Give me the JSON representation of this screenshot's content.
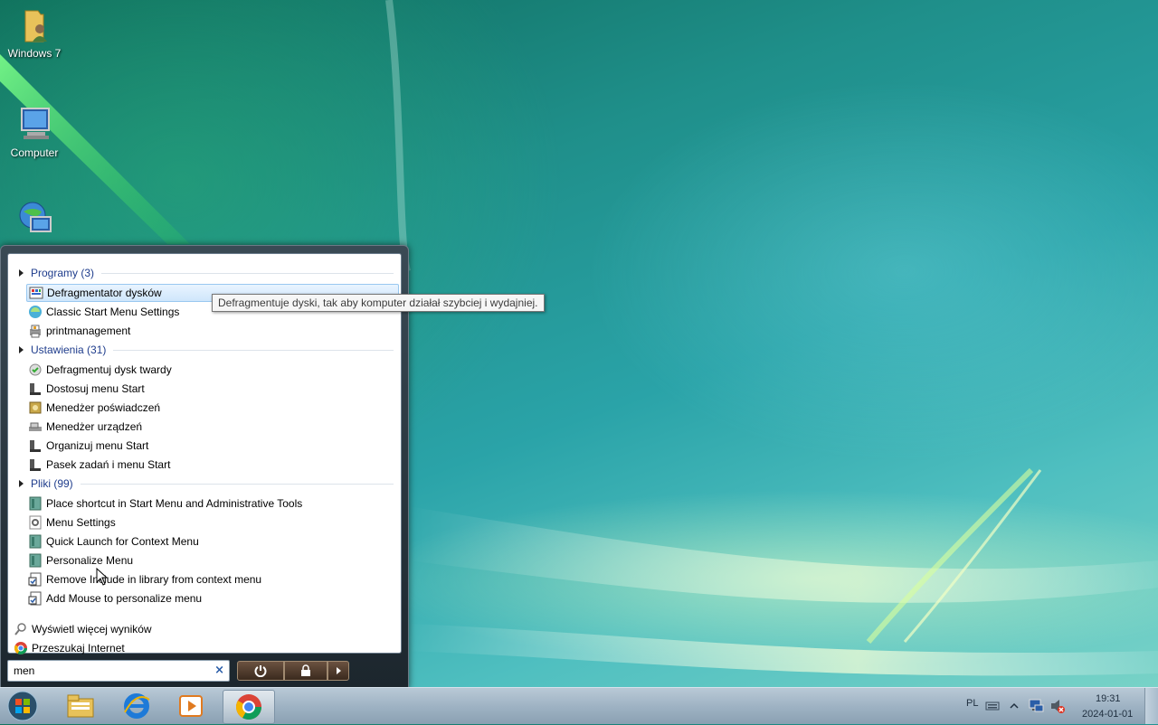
{
  "desktop": {
    "icons": [
      {
        "label": "Windows 7",
        "icon": "user-folder-icon"
      },
      {
        "label": "Computer",
        "icon": "computer-icon"
      },
      {
        "label": "",
        "icon": "network-globe-icon"
      }
    ]
  },
  "start_menu": {
    "groups": [
      {
        "header": "Programy (3)",
        "items": [
          {
            "label": "Defragmentator dysków",
            "icon": "defrag-icon",
            "selected": true
          },
          {
            "label": "Classic Start Menu Settings",
            "icon": "shell-orb-icon"
          },
          {
            "label": "printmanagement",
            "icon": "print-management-icon"
          }
        ]
      },
      {
        "header": "Ustawienia (31)",
        "items": [
          {
            "label": "Defragmentuj dysk twardy",
            "icon": "defrag-settings-icon"
          },
          {
            "label": "Dostosuj menu Start",
            "icon": "taskbar-settings-icon"
          },
          {
            "label": "Menedżer poświadczeń",
            "icon": "credential-manager-icon"
          },
          {
            "label": "Menedżer urządzeń",
            "icon": "device-manager-icon"
          },
          {
            "label": "Organizuj menu Start",
            "icon": "taskbar-settings-icon"
          },
          {
            "label": "Pasek zadań i menu Start",
            "icon": "taskbar-settings-icon"
          }
        ]
      },
      {
        "header": "Pliki (99)",
        "items": [
          {
            "label": "Place shortcut in Start Menu and Administrative Tools",
            "icon": "registry-file-icon"
          },
          {
            "label": "Menu Settings",
            "icon": "settings-file-icon"
          },
          {
            "label": "Quick Launch for Context Menu",
            "icon": "registry-file-icon"
          },
          {
            "label": "Personalize Menu",
            "icon": "registry-file-icon"
          },
          {
            "label": "Remove Include in library from context menu",
            "icon": "script-file-icon"
          },
          {
            "label": "Add Mouse to personalize menu",
            "icon": "script-file-icon"
          }
        ]
      }
    ],
    "see_more": "Wyświetl więcej wyników",
    "search_internet": "Przeszukaj Internet",
    "search": {
      "value": "men",
      "clear_icon": "×"
    },
    "power_buttons": [
      "power-icon",
      "lock-icon",
      "arrow-right-icon"
    ]
  },
  "tooltip": "Defragmentuje dyski, tak aby komputer działał szybciej i wydajniej.",
  "taskbar": {
    "pinned": [
      "explorer-icon",
      "internet-explorer-icon",
      "media-player-icon",
      "chrome-icon"
    ],
    "language": "PL",
    "time": "19:31",
    "date": "2024-01-01"
  },
  "colors": {
    "group_header": "#1e3c8c",
    "selection": "#cfe6fb",
    "taskbar": "#9fb3c4"
  }
}
